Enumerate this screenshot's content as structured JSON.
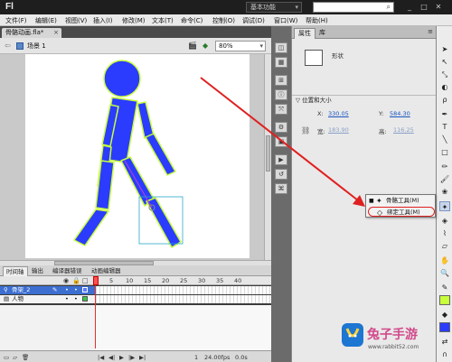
{
  "app": {
    "logo": "Fl"
  },
  "titlebar": {
    "workspace": "基本功能",
    "search_placeholder": ""
  },
  "menubar": {
    "items": [
      "文件(F)",
      "编辑(E)",
      "视图(V)",
      "插入(I)",
      "修改(M)",
      "文本(T)",
      "命令(C)",
      "控制(O)",
      "调试(D)",
      "窗口(W)",
      "帮助(H)"
    ]
  },
  "document": {
    "tab_title": "骨骼动画.fla*",
    "scene_label": "场景 1",
    "zoom": "80%"
  },
  "timeline": {
    "tabs": [
      "时间轴",
      "输出",
      "编译器错误",
      "动画编辑器"
    ],
    "frame_numbers": [
      "5",
      "10",
      "15",
      "20",
      "25",
      "30",
      "35",
      "40"
    ],
    "layers": [
      {
        "name": "骨架_2",
        "selected": true
      },
      {
        "name": "人物",
        "selected": false
      }
    ],
    "footer": {
      "frame": "1",
      "fps": "24.00fps",
      "time": "0.0s"
    }
  },
  "properties": {
    "tabs": [
      "属性",
      "库"
    ],
    "shape_label": "形状",
    "section_header": "位置和大小",
    "x_label": "X:",
    "x_value": "330.05",
    "y_label": "Y:",
    "y_value": "584.30",
    "w_label": "宽:",
    "w_value": "183.90",
    "h_label": "高:",
    "h_value": "116.25"
  },
  "flyout": {
    "items": [
      {
        "label": "骨骼工具(M)",
        "icon": "bone-tool-icon",
        "active": true
      },
      {
        "label": "绑定工具(M)",
        "icon": "bind-tool-icon",
        "active": false
      }
    ]
  },
  "watermark": {
    "text": "兔子手游",
    "url": "www.rabbit52.com"
  },
  "colors": {
    "figure_fill": "#2b3cff",
    "figure_outline": "#c8ff3a",
    "annotation_red": "#e02020",
    "bone_line": "#b040d0"
  }
}
